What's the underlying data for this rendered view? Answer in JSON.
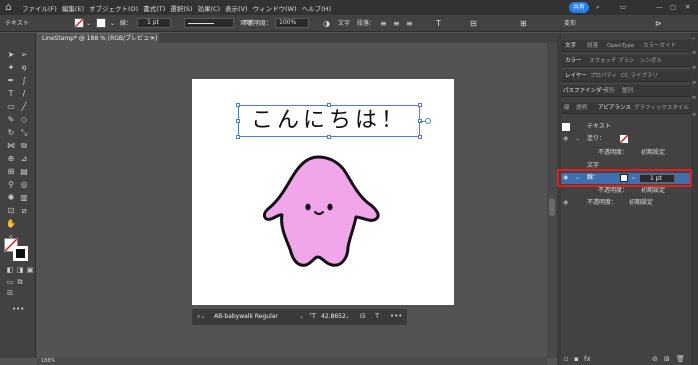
{
  "menubar": {
    "items": [
      "ファイル(F)",
      "編集(E)",
      "オブジェクト(O)",
      "書式(T)",
      "選択(S)",
      "効果(C)",
      "表示(V)",
      "ウィンドウ(W)",
      "ヘルプ(H)"
    ],
    "share_label": "共有"
  },
  "control_bar": {
    "selection_label": "テキスト",
    "stroke_label": "線：",
    "stroke_weight": "1 pt",
    "brush_label": "均等",
    "opacity_label": "不透明度：",
    "opacity_value": "100%",
    "char_label": "文字",
    "para_label": "段落：",
    "transform_label": "変形"
  },
  "document": {
    "tab_title": "LineStamp* @ 188 % (RGB/プレビュー)",
    "close_icon_label": "×"
  },
  "artboard": {
    "text": "こんにちは！"
  },
  "context_bar": {
    "font_name": "AB-babywalk Regular",
    "font_size": "42.8652",
    "more_label": "•••"
  },
  "status_bar": {
    "zoom": "188%"
  },
  "panel": {
    "tab_rows": [
      [
        "文字",
        "段落",
        "OpenType",
        "カラーガイド"
      ],
      [
        "カラー",
        "スウォッチ",
        "ブラシ",
        "シンボル"
      ],
      [
        "レイヤー",
        "プロパティ",
        "CC ライブラリ"
      ],
      [
        "パスファインダー",
        "変形",
        "整列"
      ],
      [
        "線",
        "透明",
        "アピアランス",
        "グラフィックスタイル"
      ]
    ],
    "appearance": {
      "object_label": "テキスト",
      "fill_label": "塗り：",
      "opacity_label": "不透明度：",
      "opacity_value": "初期設定",
      "char_label": "文字",
      "stroke_label": "線：",
      "stroke_weight": "1 pt",
      "stroke_opacity_label": "不透明度：",
      "stroke_opacity_value": "初期設定",
      "row3_label": "不透明度：",
      "row3_value": "初期設定"
    }
  },
  "colors": {
    "highlight": "#e0201f",
    "selection_blue": "#4a7fd9",
    "share_blue": "#2680eb",
    "character_pink": "#f2a6ea"
  }
}
